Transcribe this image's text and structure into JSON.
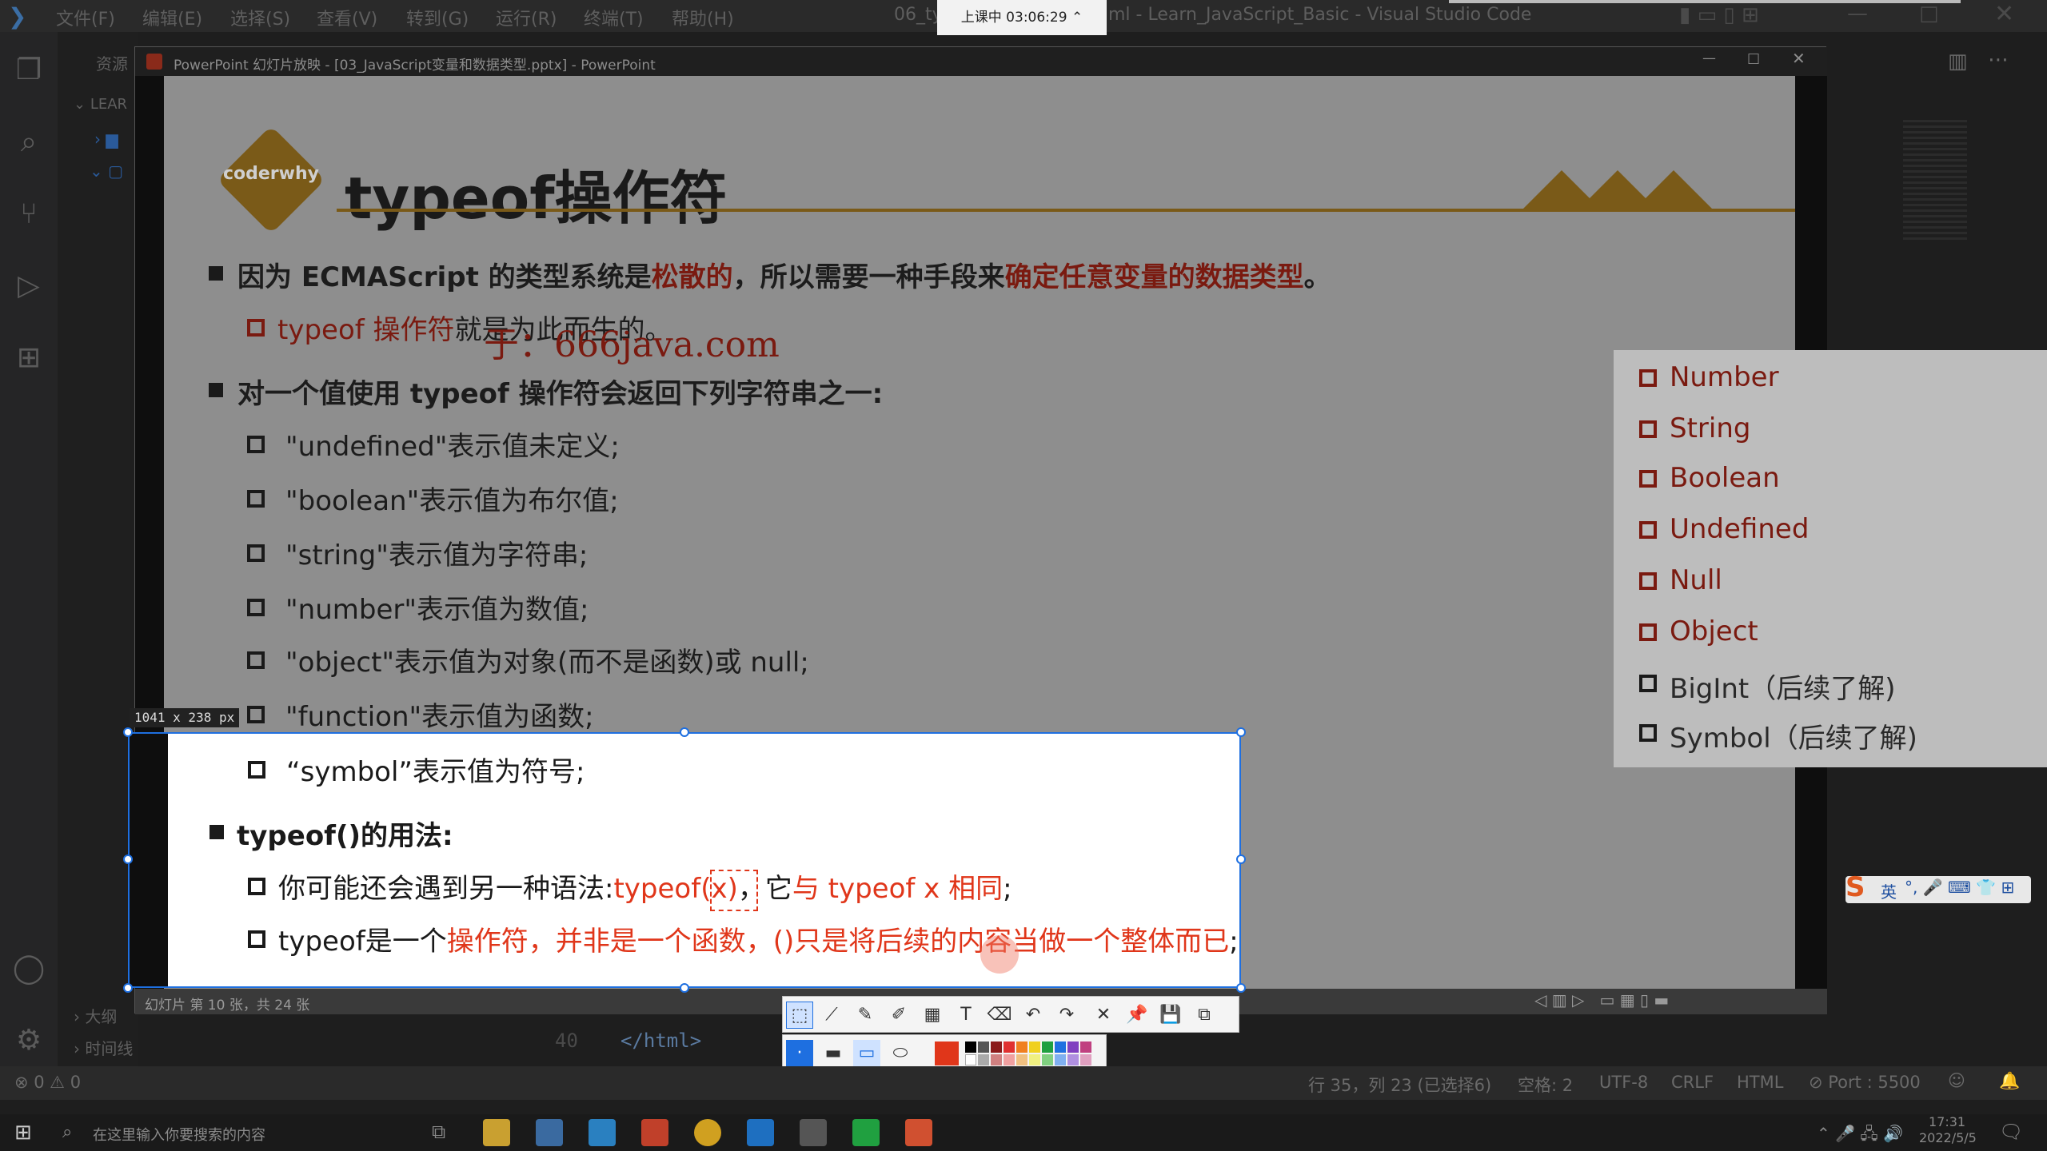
{
  "vscode": {
    "menu": [
      "文件(F)",
      "编辑(E)",
      "选择(S)",
      "查看(V)",
      "转到(G)",
      "运行(R)",
      "终端(T)",
      "帮助(H)"
    ],
    "title_left": "06_ty",
    "title_right": "ml - Learn_JavaScript_Basic - Visual Studio Code",
    "explorer_label": "资源",
    "tree_root": "LEAR",
    "outline": "大纲",
    "timeline": "时间线",
    "code_line_no": "40",
    "code_line": "</html>",
    "status_left": "⊗ 0 ⚠ 0",
    "status_items": [
      "行 35，列 23 (已选择6)",
      "空格: 2",
      "UTF-8",
      "CRLF",
      "HTML",
      "⊘ Port : 5500"
    ]
  },
  "recording": {
    "label": "上课中 03:06:29"
  },
  "ppt": {
    "window_title": "PowerPoint 幻灯片放映 - [03_JavaScript变量和数据类型.pptx] - PowerPoint",
    "status": "幻灯片 第 10 张，共 24 张",
    "slide": {
      "logo_text": "coderwhy",
      "title": "typeof操作符",
      "b1_a": "因为 ECMAScript 的类型系统是",
      "b1_b": "松散的",
      "b1_c": "，所以需要一种手段来",
      "b1_d": "确定任意变量的数据类型",
      "b1_e": "。",
      "b1_sub_a": "typeof 操作符",
      "b1_sub_b": "就是为此而生的。",
      "watermark": "于：666java.com",
      "b2": "对一个值使用 typeof 操作符会返回下列字符串之一:",
      "returns": [
        "\"undefined\"表示值未定义;",
        "\"boolean\"表示值为布尔值;",
        "\"string\"表示值为字符串;",
        "\"number\"表示值为数值;",
        "\"object\"表示值为对象(而不是函数)或 null;",
        "\"function\"表示值为函数;"
      ],
      "symbol_line": "“symbol”表示值为符号;",
      "b3": "typeof()的用法:",
      "b3_sub1_a": "你可能还会遇到另一种语法:",
      "b3_sub1_b": "typeof(x)",
      "b3_sub1_c": "，它",
      "b3_sub1_d": "与 typeof x 相同",
      "b3_sub1_e": ";",
      "b3_sub2_a": "typeof是一个",
      "b3_sub2_b": "操作符，并非是一个函数，()只是将后续的内容当做一个整体而已",
      "b3_sub2_c": ";"
    }
  },
  "capture": {
    "size_tip": "1041 x 238  px"
  },
  "type_list": [
    {
      "label": "Number",
      "red": true
    },
    {
      "label": "String",
      "red": true
    },
    {
      "label": "Boolean",
      "red": true
    },
    {
      "label": "Undefined",
      "red": true
    },
    {
      "label": "Null",
      "red": true
    },
    {
      "label": "Object",
      "red": true
    },
    {
      "label": "BigInt（后续了解)",
      "red": false
    },
    {
      "label": "Symbol（后续了解)",
      "red": false
    }
  ],
  "colors": {
    "accent_red": "#e0361a",
    "selection_blue": "#1e6fe0",
    "brand_gold": "#c9962b"
  },
  "taskbar": {
    "search_placeholder": "在这里输入你要搜索的内容",
    "time": "17:31",
    "date": "2022/5/5",
    "ime": "英"
  }
}
